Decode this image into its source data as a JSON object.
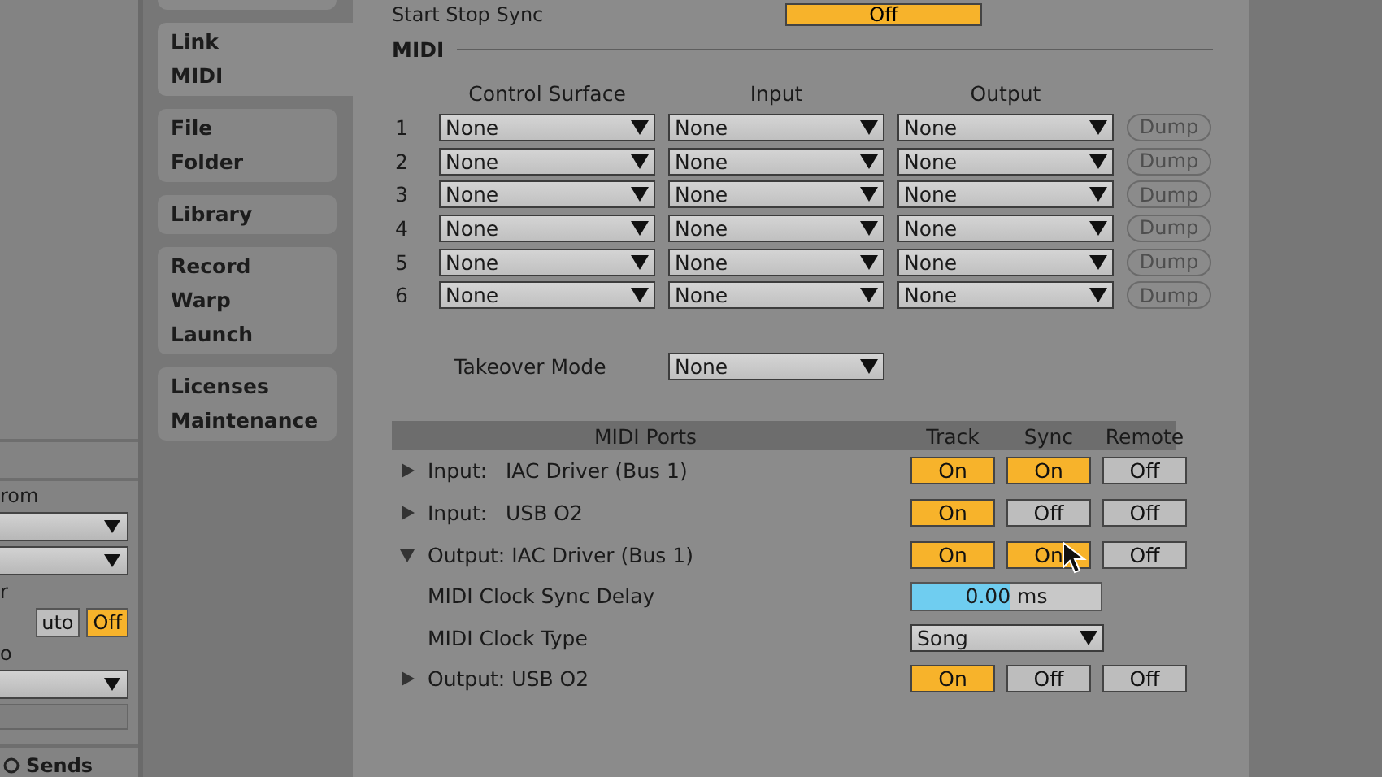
{
  "left_panel": {
    "items": [
      {
        "kind": "label",
        "text": "rom"
      },
      {
        "kind": "dropdown"
      },
      {
        "kind": "dropdown"
      },
      {
        "kind": "label",
        "text": "r"
      },
      {
        "kind": "toggles",
        "buttons": [
          {
            "label": "uto",
            "on": false
          },
          {
            "label": "Off",
            "on": true
          }
        ]
      },
      {
        "kind": "label",
        "text": "o"
      },
      {
        "kind": "dropdown"
      },
      {
        "kind": "field"
      }
    ],
    "footer": "Sends"
  },
  "sidebar": {
    "groups": [
      {
        "items": [
          "Link",
          "MIDI"
        ],
        "selected": true
      },
      {
        "items": [
          "File",
          "Folder"
        ],
        "selected": false
      },
      {
        "items": [
          "Library"
        ],
        "selected": false
      },
      {
        "items": [
          "Record",
          "Warp",
          "Launch"
        ],
        "selected": false
      },
      {
        "items": [
          "Licenses",
          "Maintenance"
        ],
        "selected": false
      }
    ]
  },
  "sync_row": {
    "label": "Start Stop Sync",
    "button": {
      "label": "Off",
      "on": true
    }
  },
  "midi": {
    "title": "MIDI",
    "columns": [
      "Control Surface",
      "Input",
      "Output"
    ],
    "rows": [
      {
        "number": "1",
        "control_surface": "None",
        "input": "None",
        "output": "None",
        "dump": "Dump",
        "disabled": true
      },
      {
        "number": "2",
        "control_surface": "None",
        "input": "None",
        "output": "None",
        "dump": "Dump",
        "disabled": true
      },
      {
        "number": "3",
        "control_surface": "None",
        "input": "None",
        "output": "None",
        "dump": "Dump",
        "disabled": true
      },
      {
        "number": "4",
        "control_surface": "None",
        "input": "None",
        "output": "None",
        "dump": "Dump",
        "disabled": true
      },
      {
        "number": "5",
        "control_surface": "None",
        "input": "None",
        "output": "None",
        "dump": "Dump",
        "disabled": true
      },
      {
        "number": "6",
        "control_surface": "None",
        "input": "None",
        "output": "None",
        "dump": "Dump",
        "disabled": true
      }
    ],
    "takeover": {
      "label": "Takeover Mode",
      "value": "None"
    }
  },
  "ports": {
    "columns": [
      "MIDI Ports",
      "Track",
      "Sync",
      "Remote"
    ],
    "rows": [
      {
        "kind": "port",
        "expanded": false,
        "direction": "Input:",
        "name": "IAC Driver (Bus 1)",
        "track": {
          "label": "On",
          "on": true
        },
        "sync": {
          "label": "On",
          "on": true
        },
        "remote": {
          "label": "Off",
          "on": false
        }
      },
      {
        "kind": "port",
        "expanded": false,
        "direction": "Input:",
        "name": "USB O2",
        "track": {
          "label": "On",
          "on": true
        },
        "sync": {
          "label": "Off",
          "on": false
        },
        "remote": {
          "label": "Off",
          "on": false
        }
      },
      {
        "kind": "port",
        "expanded": true,
        "direction": "Output:",
        "name": "IAC Driver (Bus 1)",
        "track": {
          "label": "On",
          "on": true
        },
        "sync": {
          "label": "On",
          "on": true
        },
        "remote": {
          "label": "Off",
          "on": false
        }
      },
      {
        "kind": "slider",
        "label": "MIDI Clock Sync Delay",
        "value": "0.00 ms",
        "level": 0.52
      },
      {
        "kind": "dropdown",
        "label": "MIDI Clock Type",
        "value": "Song"
      },
      {
        "kind": "port",
        "expanded": false,
        "direction": "Output:",
        "name": "USB O2",
        "track": {
          "label": "On",
          "on": true
        },
        "sync": {
          "label": "Off",
          "on": false
        },
        "remote": {
          "label": "Off",
          "on": false
        }
      }
    ]
  }
}
